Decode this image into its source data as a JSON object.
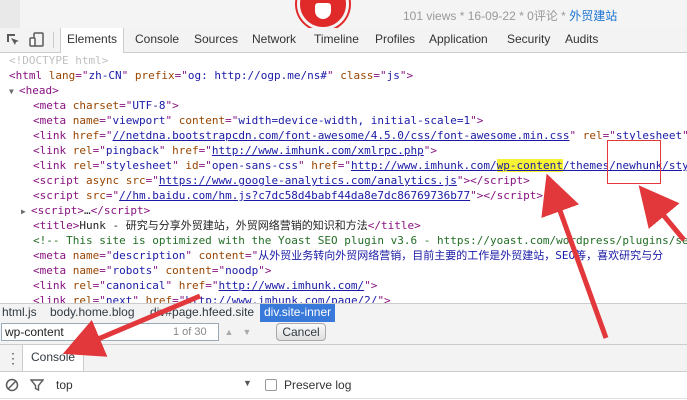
{
  "page_behind": {
    "meta_views": "101 views",
    "meta_date": "16-09-22",
    "meta_comments": "0评论",
    "meta_category": "外贸建站"
  },
  "devtools": {
    "tabs": [
      {
        "label": "Elements",
        "active": true
      },
      {
        "label": "Console"
      },
      {
        "label": "Sources"
      },
      {
        "label": "Network"
      },
      {
        "label": "Timeline"
      },
      {
        "label": "Profiles"
      },
      {
        "label": "Application"
      },
      {
        "label": "Security"
      },
      {
        "label": "Audits"
      }
    ],
    "icons": [
      "inspect-icon",
      "device-mode-icon"
    ]
  },
  "tree": {
    "doctype": "<!DOCTYPE html>",
    "html_open": {
      "tag": "html",
      "attrs": [
        [
          "lang",
          "zh-CN"
        ],
        [
          "prefix",
          "og: http://ogp.me/ns#"
        ],
        [
          "class",
          "js"
        ]
      ]
    },
    "head_open": "head",
    "meta_charset": {
      "tag": "meta",
      "name": "charset",
      "value": "UTF-8"
    },
    "meta_viewport": {
      "tag": "meta",
      "a1": "name",
      "v1": "viewport",
      "a2": "content",
      "v2": "width=device-width, initial-scale=1"
    },
    "link_fa": {
      "tag": "link",
      "a1": "href",
      "v1": "//netdna.bootstrapcdn.com/font-awesome/4.5.0/css/font-awesome.min.css",
      "a2": "rel",
      "v2": "stylesheet"
    },
    "link_pingback": {
      "tag": "link",
      "a1": "rel",
      "v1": "pingback",
      "a2": "href",
      "v2": "http://www.imhunk.com/xmlrpc.php"
    },
    "link_style": {
      "tag": "link",
      "a1": "rel",
      "v1": "stylesheet",
      "a2": "id",
      "v2": "open-sans-css",
      "a3": "href",
      "v3a": "http://www.imhunk.com/",
      "v3hl": "wp-content",
      "v3b": "/themes/newhunk/sty"
    },
    "script_ga": {
      "tag": "script",
      "a1": "async src",
      "v1": "https://www.google-analytics.com/analytics.js"
    },
    "script_baidu": {
      "tag": "script",
      "a1": "src",
      "v1": "//hm.baidu.com/hm.js?c7dc58d4babf44da8e7dc86769736b77"
    },
    "script_collapsed": "script",
    "script_collapsed_body": "…",
    "title": {
      "tag": "title",
      "text": "Hunk - 研究与分享外贸建站，外贸网络营销的知识和方法"
    },
    "comment": "<!-- This site is optimized with the Yoast SEO plugin v3.6 - https://yoast.com/wordpress/plugins/seo",
    "meta_desc": {
      "tag": "meta",
      "a1": "name",
      "v1": "description",
      "a2": "content",
      "v2": "从外贸业务转向外贸网络营销，目前主要的工作是外贸建站，SEO等，喜欢研究与分"
    },
    "meta_robots": {
      "tag": "meta",
      "a1": "name",
      "v1": "robots",
      "a2": "content",
      "v2": "noodp"
    },
    "link_canonical": {
      "tag": "link",
      "a1": "rel",
      "v1": "canonical",
      "a2": "href",
      "v2": "http://www.imhunk.com/"
    },
    "link_next": {
      "tag": "link",
      "a1": "rel",
      "v1": "next",
      "a2": "href",
      "v2": "http://www.imhunk.com/page/2/"
    }
  },
  "breadcrumbs": [
    "html.js",
    "body.home.blog",
    "div#page.hfeed.site",
    "div.site-inner"
  ],
  "search": {
    "value": "wp-content",
    "count": "1 of 30",
    "cancel_label": "Cancel"
  },
  "drawer": {
    "tab_label": "Console",
    "context": "top",
    "preserve_log_label": "Preserve log"
  },
  "colors": {
    "annotation_red": "#e2373b",
    "highlight": "#f7f334",
    "crumb_active": "#3879d9"
  }
}
